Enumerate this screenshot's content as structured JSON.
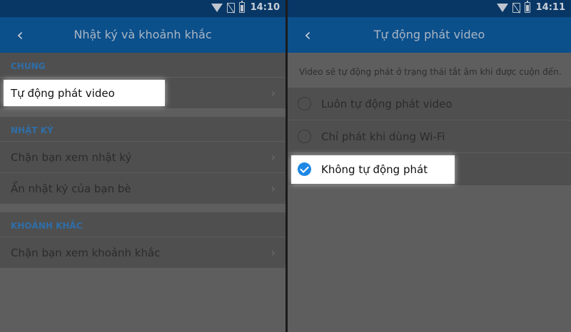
{
  "left": {
    "status": {
      "time": "14:10"
    },
    "header": {
      "title": "Nhật ký và khoảnh khắc"
    },
    "sections": [
      {
        "header": "CHUNG",
        "items": [
          {
            "label": "Tự động phát video"
          }
        ]
      },
      {
        "header": "NHẬT KÝ",
        "items": [
          {
            "label": "Chặn bạn xem nhật ký"
          },
          {
            "label": "Ẩn nhật ký của bạn bè"
          }
        ]
      },
      {
        "header": "KHOẢNH KHẮC",
        "items": [
          {
            "label": "Chặn bạn xem khoảnh khắc"
          }
        ]
      }
    ]
  },
  "right": {
    "status": {
      "time": "14:11"
    },
    "header": {
      "title": "Tự động phát video"
    },
    "description": "Video sẽ tự động phát ở trạng thái tắt âm khi được cuộn đến.",
    "options": [
      {
        "label": "Luôn tự động phát video",
        "selected": false
      },
      {
        "label": "Chỉ phát khi dùng Wi-Fi",
        "selected": false
      },
      {
        "label": "Không tự động phát",
        "selected": true
      }
    ]
  },
  "colors": {
    "accent": "#1e88e5",
    "appbar": "#0b4f8b",
    "section_header": "#2f6ea8"
  },
  "icons": {
    "back": "chevron-left-icon",
    "row": "chevron-right-icon",
    "status": [
      "wifi-icon",
      "no-sim-icon",
      "battery-icon"
    ]
  }
}
